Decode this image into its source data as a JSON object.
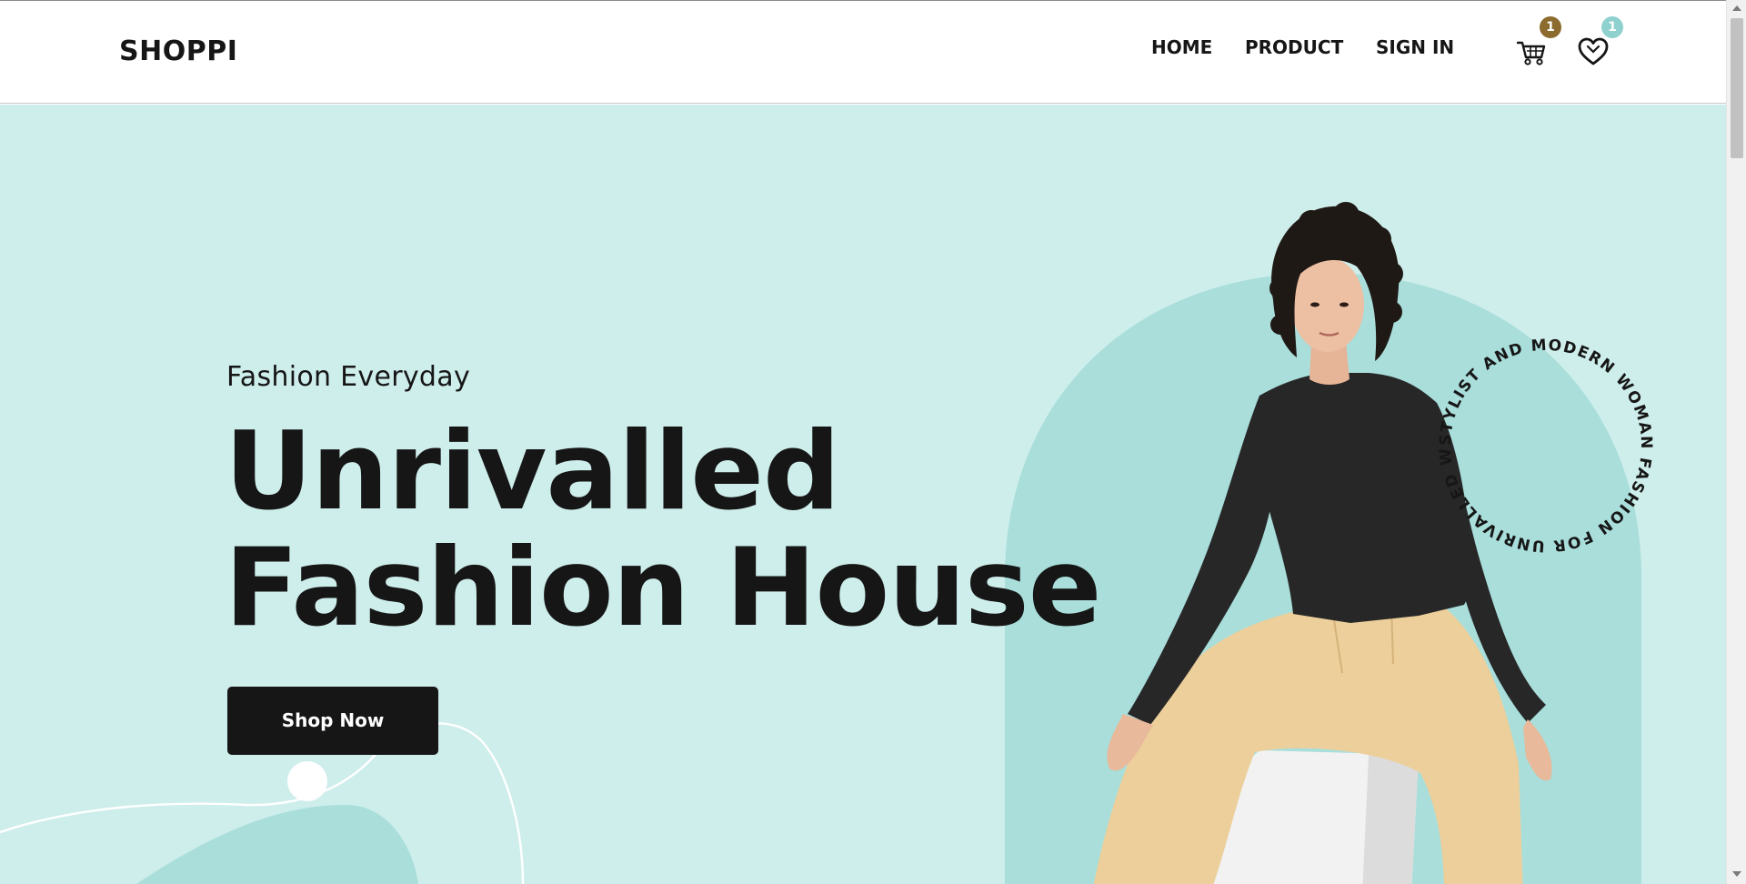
{
  "brand": "SHOPPI",
  "nav": {
    "home": "HOME",
    "product": "PRODUCT",
    "sign_in": "SIGN IN"
  },
  "header_icons": {
    "cart": {
      "icon": "cart-icon",
      "count": "1",
      "badge_color": "#8b6b2e"
    },
    "wishlist": {
      "icon": "heart-icon",
      "count": "1",
      "badge_color": "#8fd1ce"
    }
  },
  "hero": {
    "eyebrow": "Fashion Everyday",
    "headline_line1": "Unrivalled",
    "headline_line2": "Fashion House",
    "cta": "Shop Now",
    "circular_text": "STYLIST AND MODERN WOMAN FASHION FOR UNRIVALLED WOMAN",
    "background_color": "#ceeeeb",
    "accent_color": "#a6dcd9"
  }
}
